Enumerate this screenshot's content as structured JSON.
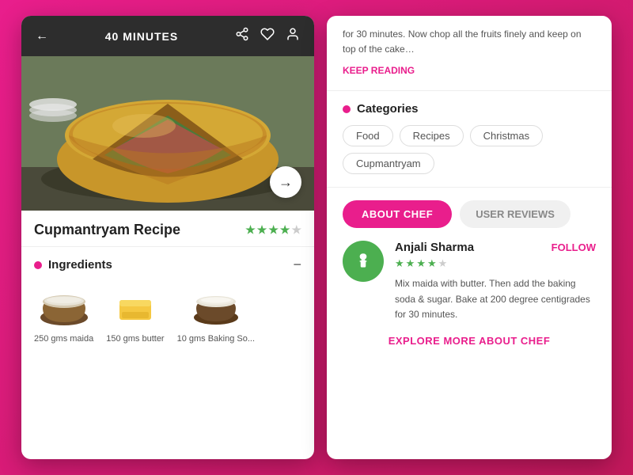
{
  "left_panel": {
    "header": {
      "time_label": "40 MINUTES",
      "back_icon": "←",
      "share_icon": "⎋",
      "heart_icon": "♡",
      "profile_icon": "⊙"
    },
    "recipe": {
      "title": "Cupmantryam Recipe",
      "stars_filled": 4,
      "stars_total": 5
    },
    "ingredients": {
      "section_title": "Ingredients",
      "items": [
        {
          "label": "250 gms maida",
          "icon": "bowl_white"
        },
        {
          "label": "150 gms butter",
          "icon": "butter"
        },
        {
          "label": "10 gms Baking So...",
          "icon": "bowl_dark"
        }
      ]
    },
    "next_arrow": "→"
  },
  "right_panel": {
    "recipe_text": "for 30 minutes. Now chop all the fruits finely and keep on top of the cake…",
    "keep_reading_label": "KEEP READING",
    "categories": {
      "section_title": "Categories",
      "tags": [
        "Food",
        "Recipes",
        "Christmas",
        "Cupmantryam"
      ]
    },
    "chef_tabs": {
      "about_label": "ABOUT CHEF",
      "reviews_label": "USER REVIEWS"
    },
    "chef": {
      "name": "Anjali Sharma",
      "stars_filled": 4,
      "stars_total": 5,
      "follow_label": "FOLLOW",
      "bio": "Mix maida with butter. Then add the baking soda & sugar. Bake at 200 degree centigrades for 30 minutes.",
      "explore_label": "EXPLORE MORE ABOUT CHEF"
    }
  }
}
